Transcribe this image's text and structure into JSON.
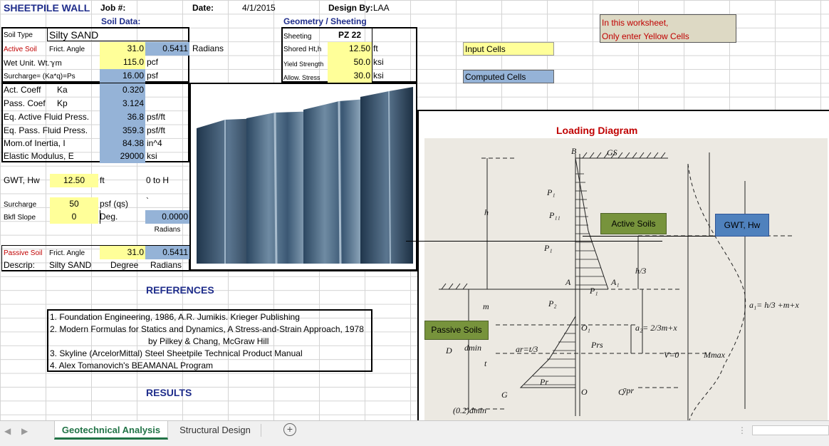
{
  "header": {
    "title": "SHEETPILE WALL",
    "job_label": "Job #:",
    "date_label": "Date:",
    "date_value": "4/1/2015",
    "design_by_label": "Design By:",
    "design_by_value": "LAA",
    "soil_data": "Soil Data:",
    "geometry": "Geometry / Sheeting"
  },
  "soil": {
    "soil_type_label": "Soil Type",
    "soil_type_value": "Silty SAND",
    "active_soil": "Active Soil",
    "frict_angle": "Frict. Angle",
    "frict_value": "31.0",
    "frict_rad": "0.5411",
    "radians": "Radians",
    "wet_unit_label": "Wet Unit. Wt.ℽm",
    "wet_unit_value": "115.0",
    "pcf": "pcf",
    "surcharge_label": "Surcharge= (Ka*q)=Ps",
    "surcharge_value": "16.00",
    "psf": "psf",
    "act_coeff_label": "Act. Coeff",
    "ka": "Ka",
    "ka_value": "0.320",
    "pass_coef_label": "Pass. Coef",
    "kp": "Kp",
    "kp_value": "3.124",
    "eq_active_label": "Eq. Active Fluid Press.",
    "eq_active_value": "36.8",
    "eq_pass_label": "Eq. Pass. Fluid Press.",
    "eq_pass_value": "359.3",
    "psf_ft": "psf/ft",
    "mom_label": "Mom.of Inertia, I",
    "mom_value": "84.38",
    "in4": "in^4",
    "elastic_label": "Elastic Modulus, E",
    "elastic_value": "29000",
    "ksi": "ksi",
    "gwt_label": "GWT, Hw",
    "gwt_value": "12.50",
    "ft": "ft",
    "zero_to_h": "0 to H",
    "surch_label": "Surcharge",
    "surch_value": "50",
    "psf_qs": "psf  (qs)",
    "backtick": "`",
    "bkfl_label": "Bkfl Slope",
    "bkfl_value": "0",
    "deg": "Deg.",
    "bkfl_rad": "0.0000",
    "radians2": "Radians",
    "passive_soil": "Passive Soil",
    "pass_frict_label": "Frict. Angle",
    "pass_frict_value": "31.0",
    "pass_frict_rad": "0.5411",
    "descrip_label": "Descrip:",
    "descrip_value": "Silty SAND",
    "degree": "Degree",
    "radians3": "Radians"
  },
  "geometry": {
    "sheeting_label": "Sheeting",
    "sheeting_value": "PZ 22",
    "shored_label": "Shored Ht,h",
    "shored_value": "12.50",
    "ft": "ft",
    "yield_label": "Yield Strength",
    "yield_value": "50.0",
    "ksi": "ksi",
    "allow_label": "Allow. Stress",
    "allow_value": "30.0",
    "ksi2": "ksi"
  },
  "legend": {
    "input": "Input Cells",
    "computed": "Computed Cells",
    "note_line1": "In this worksheet,",
    "note_line2": "Only enter Yellow Cells"
  },
  "references": {
    "title": "REFERENCES",
    "items": [
      "1. Foundation Engineering, 1986, A.R. Jumikis. Krieger Publishing",
      "2. Modern Formulas for Statics and Dynamics, A Stress-and-Strain Approach, 1978",
      "by Pilkey & Chang, McGraw Hill",
      "3. Skyline (ArcelorMittal) Steel Sheetpile Technical Product Manual",
      "4. Alex Tomanovich's BEAMANAL Program"
    ]
  },
  "results_title": "RESULTS",
  "diagram": {
    "title": "Loading Diagram",
    "active_soils": "Active Soils",
    "gwt": "GWT, Hw",
    "passive_soils": "Passive Soils",
    "labels": {
      "B": "B",
      "GS": "GS",
      "P1": "P₁",
      "P11": "P₁₁",
      "P1b": "P₁",
      "h": "h",
      "h3": "h/3",
      "A": "A",
      "A1": "A₁",
      "P1c": "P₁",
      "P2": "P₂",
      "m": "m",
      "O1": "O₁",
      "Prs": "Prs",
      "dmin": "dmin",
      "D": "D",
      "V0": "V=0",
      "Mmax": "Mmax",
      "Pr": "Pr",
      "ypr": "ȳpr",
      "G": "G",
      "O": "O",
      "C": "C",
      "d02": "(0.2)dmin",
      "t": "t",
      "a1": "a₁= h/3 +m+x",
      "a2": "a₂= 2/3m+x",
      "ar": "ar=t/3"
    }
  },
  "tabs": {
    "geotechnical": "Geotechnical Analysis",
    "structural": "Structural Design"
  },
  "colors": {
    "yellow": "#ffff99",
    "blue": "#95b3d7",
    "navy": "#1f2d8b",
    "red": "#c00000",
    "green": "#77933c",
    "blue_box": "#4f81bd"
  }
}
